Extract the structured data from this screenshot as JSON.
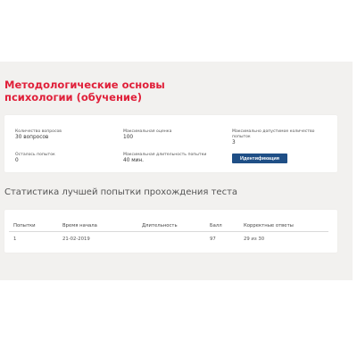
{
  "course": {
    "title": "Методологические основы психологии (обучение)"
  },
  "info": {
    "question_count_label": "Количество вопросов",
    "question_count_value": "30 вопросов",
    "max_score_label": "Максимальная оценка",
    "max_score_value": "100",
    "max_attempts_label": "Максимально допустимое количество попыток",
    "max_attempts_value": "3",
    "attempts_left_label": "Осталось попыток",
    "attempts_left_value": "0",
    "max_duration_label": "Максимальная длительность попытки",
    "max_duration_value": "40 мин.",
    "identify_button": "Идентификация"
  },
  "stats": {
    "heading": "Статистика лучшей попытки прохождения теста",
    "columns": [
      "Попытки",
      "Время начала",
      "Длительность",
      "Балл",
      "Корректные ответы"
    ],
    "rows": [
      [
        "1",
        "21-02-2019",
        "",
        "97",
        "29 из 30"
      ]
    ]
  }
}
